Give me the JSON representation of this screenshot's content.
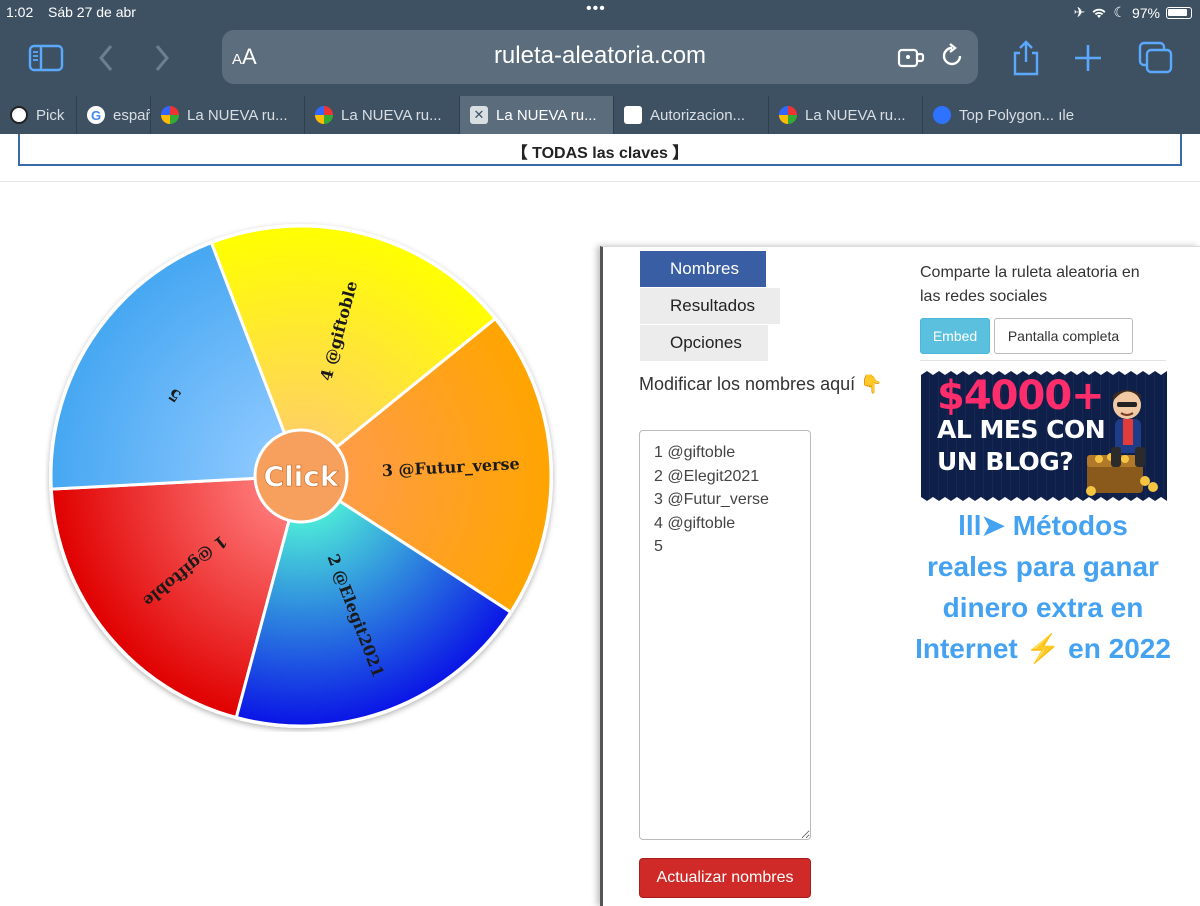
{
  "status_bar": {
    "time": "1:02",
    "date": "Sáb 27 de abr",
    "battery": "97%"
  },
  "browser": {
    "aa_label": "AA",
    "url": "ruleta-aleatoria.com",
    "tabs": [
      {
        "label": "Pick",
        "icon": "pick-icon"
      },
      {
        "label": "españ",
        "icon": "google-icon"
      },
      {
        "label": "La NUEVA ru...",
        "icon": "wheel-favicon"
      },
      {
        "label": "La NUEVA ru...",
        "icon": "wheel-favicon"
      },
      {
        "label": "La NUEVA ru...",
        "icon": "close-tab-icon",
        "active": true
      },
      {
        "label": "Autorizacion...",
        "icon": "shield-icon"
      },
      {
        "label": "La NUEVA ru...",
        "icon": "wheel-favicon"
      },
      {
        "label": "Top Polygon... ıle",
        "icon": "polygon-icon"
      }
    ]
  },
  "page": {
    "claves_link": "【 TODAS las claves 】",
    "wheel": {
      "center_label": "Click",
      "segments": [
        {
          "label": "1 @giftoble",
          "color_light": "#ff7a7a",
          "color_dark": "#e00000"
        },
        {
          "label": "5",
          "color_light": "#8cc8ff",
          "color_dark": "#46a7f2"
        },
        {
          "label": "4 @giftoble",
          "color_light": "#ffd064",
          "color_dark": "#ffff00"
        },
        {
          "label": "3 @Futur_verse",
          "color_light": "#ff9c4a",
          "color_dark": "#ffa500"
        },
        {
          "label": "2 @Elegit2021",
          "color_light": "#4ff0d8",
          "color_dark": "#0a14e6"
        }
      ]
    },
    "tabs": {
      "names": "Nombres",
      "results": "Resultados",
      "options": "Opciones"
    },
    "modify_label": "Modificar los nombres aquí 👇",
    "names_text": "1 @giftoble\n2 @Elegit2021\n3 @Futur_verse\n4 @giftoble\n5",
    "update_button": "Actualizar nombres",
    "share_text": "Comparte la ruleta aleatoria en las redes sociales",
    "embed_button": "Embed",
    "fullscreen_button": "Pantalla completa",
    "ad": {
      "line1": "$4000+",
      "line2": "AL MES CON",
      "line3": "UN BLOG?"
    },
    "promo_text": "lll➤ Métodos reales para ganar dinero extra en Internet ⚡ en 2022"
  }
}
